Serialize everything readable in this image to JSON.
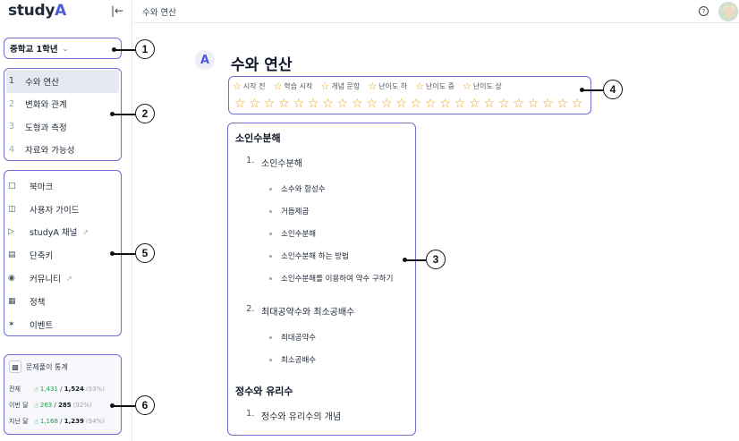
{
  "app": {
    "logo_text": "study",
    "logo_mark": "A"
  },
  "topbar": {
    "breadcrumb": "수와 연산"
  },
  "sidebar": {
    "grade_select": {
      "value": "중학교 1학년"
    },
    "units": [
      {
        "num": "1",
        "label": "수와 연산",
        "active": true
      },
      {
        "num": "2",
        "label": "변화와 관계"
      },
      {
        "num": "3",
        "label": "도형과 측정"
      },
      {
        "num": "4",
        "label": "자료와 가능성"
      }
    ],
    "menu": [
      {
        "icon": "bookmark-icon",
        "label": "북마크"
      },
      {
        "icon": "book-icon",
        "label": "사용자 가이드"
      },
      {
        "icon": "youtube-icon",
        "label": "studyA 채널",
        "external": true
      },
      {
        "icon": "keyboard-icon",
        "label": "단축키"
      },
      {
        "icon": "discord-icon",
        "label": "커뮤니티",
        "external": true
      },
      {
        "icon": "policy-icon",
        "label": "정책"
      },
      {
        "icon": "event-icon",
        "label": "이벤트"
      }
    ],
    "stats": {
      "title": "문제풀이 통계",
      "rows": [
        {
          "label": "전체",
          "solved": "1,431",
          "total": "1,524",
          "pct": "(93%)"
        },
        {
          "label": "이번 달",
          "solved": "263",
          "total": "285",
          "pct": "(92%)"
        },
        {
          "label": "지난 달",
          "solved": "1,168",
          "total": "1,239",
          "pct": "(94%)"
        }
      ]
    }
  },
  "main": {
    "title": "수와 연산",
    "legend": [
      {
        "label": "시작 전"
      },
      {
        "label": "학습 시작"
      },
      {
        "label": "개념 문항"
      },
      {
        "label": "난이도 하"
      },
      {
        "label": "난이도 중"
      },
      {
        "label": "난이도 상"
      }
    ],
    "star_count": 24,
    "toc": [
      {
        "title": "소인수분해",
        "subs": [
          {
            "num": "1.",
            "label": "소인수분해",
            "leaves": [
              "소수와 합성수",
              "거듭제곱",
              "소인수분해",
              "소인수분해 하는 방법",
              "소인수분해를 이용하여 약수 구하기"
            ]
          },
          {
            "num": "2.",
            "label": "최대공약수와 최소공배수",
            "leaves": [
              "최대공약수",
              "최소공배수"
            ]
          }
        ]
      },
      {
        "title": "정수와 유리수",
        "subs": [
          {
            "num": "1.",
            "label": "정수와 유리수의 개념",
            "leaves": []
          }
        ]
      }
    ]
  },
  "annotations": [
    "1",
    "2",
    "3",
    "4",
    "5",
    "6"
  ],
  "colors": {
    "accent": "#4f5bd5",
    "outline": "#6d6fd1",
    "star": "#e8a317",
    "success": "#16a34a"
  }
}
